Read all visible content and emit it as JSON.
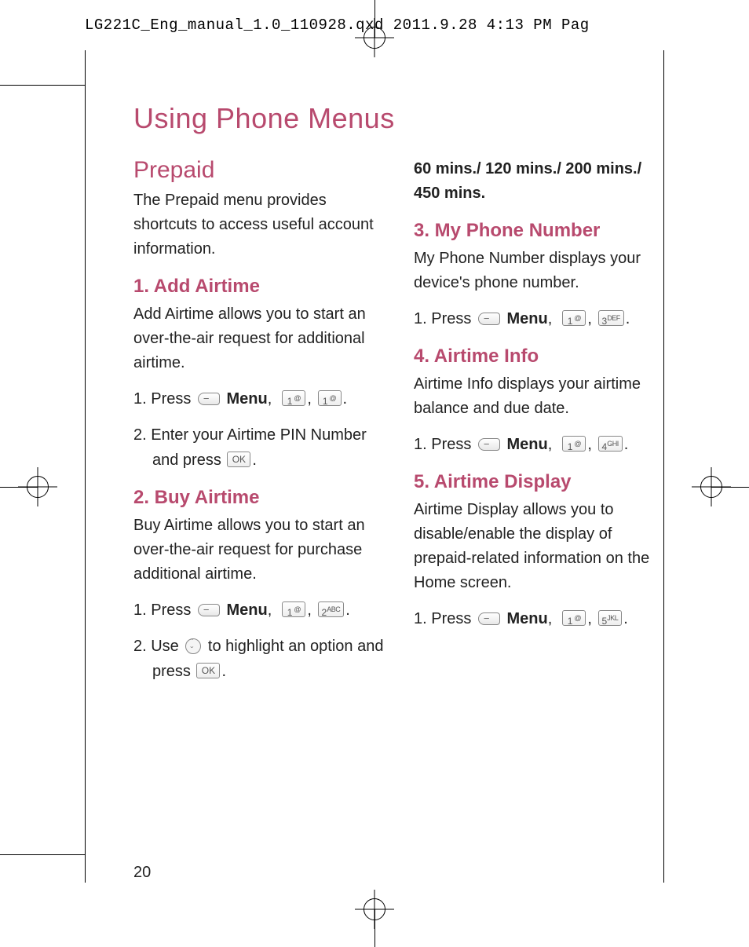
{
  "header": "LG221C_Eng_manual_1.0_110928.qxd  2011.9.28  4:13 PM  Pag",
  "title": "Using Phone Menus",
  "page_number": "20",
  "prepaid": {
    "heading": "Prepaid",
    "intro": "The Prepaid menu provides shortcuts to access useful account information."
  },
  "s1": {
    "heading": "1. Add Airtime",
    "intro": "Add Airtime allows you to start an over-the-air request for additional airtime.",
    "step1_a": "1. Press ",
    "menu": "Menu",
    "step2": "2. Enter your Airtime PIN Number and press "
  },
  "s2": {
    "heading": "2. Buy Airtime",
    "intro": "Buy Airtime allows you to start an over-the-air request for purchase additional airtime.",
    "step1_a": "1. Press ",
    "menu": "Menu",
    "step2_a": "2. Use ",
    "step2_b": " to highlight an option and press ",
    "options": "60 mins./ 120 mins./ 200 mins./ 450 mins."
  },
  "s3": {
    "heading": "3. My Phone Number",
    "intro": "My Phone Number displays your device's phone number.",
    "step1_a": "1. Press ",
    "menu": "Menu"
  },
  "s4": {
    "heading": "4. Airtime Info",
    "intro": "Airtime Info displays your airtime balance and due date.",
    "step1_a": "1. Press ",
    "menu": "Menu"
  },
  "s5": {
    "heading": "5. Airtime Display",
    "intro": "Airtime Display allows you to disable/enable the display of prepaid-related information on the Home screen.",
    "step1_a": "1. Press ",
    "menu": "Menu"
  },
  "keys": {
    "one": "1",
    "two": "2",
    "three": "3",
    "four": "4",
    "five": "5",
    "ok": "OK",
    "abc": "ABC",
    "def": "DEF",
    "ghi": "GHI",
    "jkl": "JKL"
  }
}
